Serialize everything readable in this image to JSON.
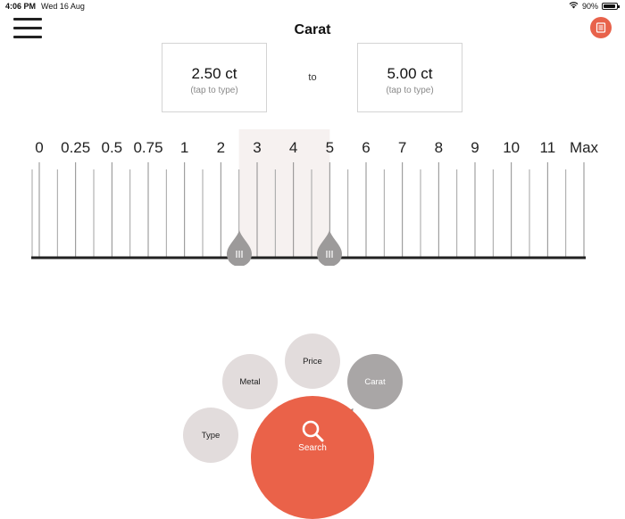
{
  "status_bar": {
    "time": "4:06 PM",
    "date": "Wed 16 Aug",
    "battery": "90%",
    "battery_level": 0.9
  },
  "header": {
    "title": "Carat",
    "menu_icon": "hamburger-menu-icon",
    "list_icon": "list-icon",
    "accent": "#e8624b"
  },
  "range": {
    "min_value": "2.50 ct",
    "max_value": "5.00 ct",
    "min_hint": "(tap to type)",
    "max_hint": "(tap to type)",
    "separator": "to",
    "selected_min": 2.5,
    "selected_max": 5.0
  },
  "ruler": {
    "labels": [
      "0",
      "0.25",
      "0.5",
      "0.75",
      "1",
      "2",
      "3",
      "4",
      "5",
      "6",
      "7",
      "8",
      "9",
      "10",
      "11",
      "Max"
    ],
    "selected_start_label": "3",
    "selected_end_label": "5"
  },
  "filters": {
    "type": "Type",
    "metal": "Metal",
    "price": "Price",
    "carat": "Carat",
    "search": "Search",
    "active": "Carat"
  }
}
